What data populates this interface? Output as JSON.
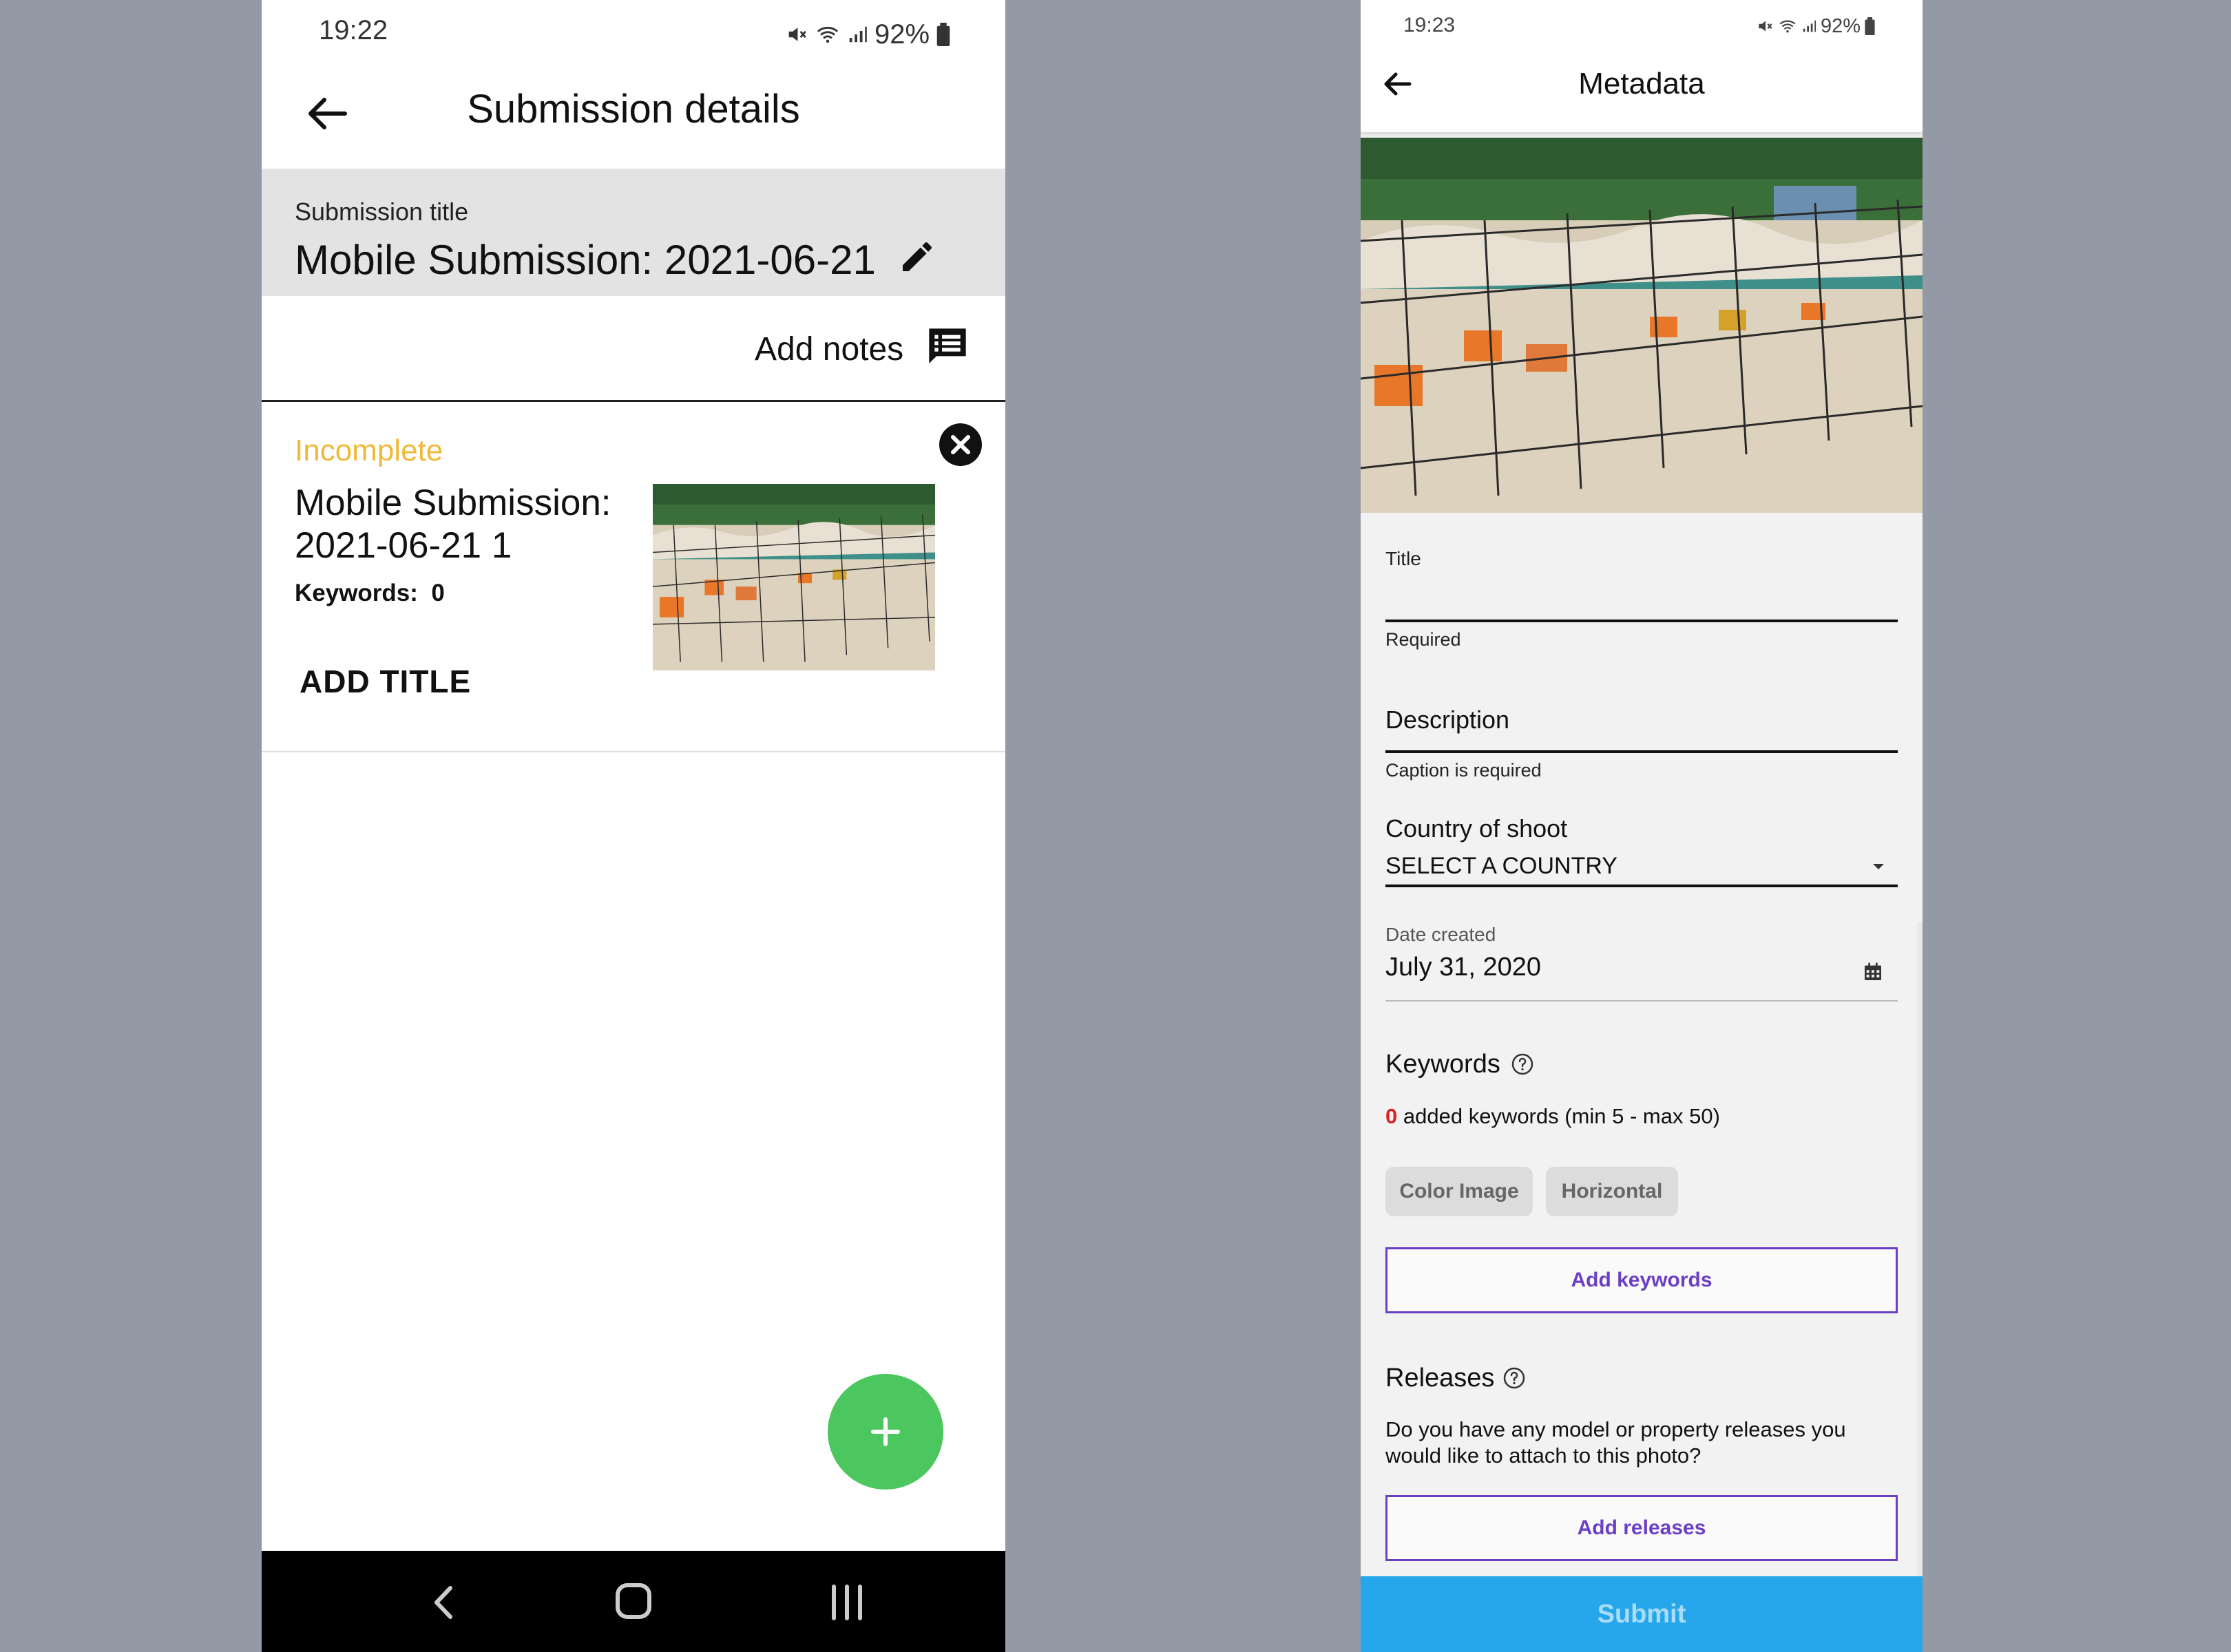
{
  "left": {
    "status": {
      "time": "19:22",
      "battery": "92%"
    },
    "appbar": {
      "title": "Submission details"
    },
    "submission": {
      "label": "Submission title",
      "value": "Mobile Submission: 2021-06-21"
    },
    "notes": {
      "label": "Add notes"
    },
    "card": {
      "status": "Incomplete",
      "title": "Mobile Submission: 2021-06-21 1",
      "keywords_label": "Keywords:",
      "keywords_count": "0",
      "add_title": "ADD TITLE"
    },
    "fab": {
      "icon": "plus-icon"
    },
    "nav": {
      "back": "back-nav-icon",
      "home": "home-nav-icon",
      "recents": "recents-nav-icon"
    }
  },
  "right": {
    "status": {
      "time": "19:23",
      "battery": "92%"
    },
    "appbar": {
      "title": "Metadata"
    },
    "title_field": {
      "label": "Title",
      "helper": "Required"
    },
    "description_field": {
      "label": "Description",
      "helper": "Caption is required"
    },
    "country_field": {
      "label": "Country of shoot",
      "value": "SELECT A COUNTRY"
    },
    "date_field": {
      "label": "Date created",
      "value": "July 31, 2020"
    },
    "keywords": {
      "title": "Keywords",
      "count": "0",
      "count_suffix": "added keywords (min 5 - max 50)",
      "chips": [
        "Color Image",
        "Horizontal"
      ],
      "add_button": "Add keywords"
    },
    "releases": {
      "title": "Releases",
      "question": "Do you have any model or property releases you would like to attach to this photo?",
      "add_button": "Add releases"
    },
    "submit": "Submit"
  },
  "colors": {
    "incomplete": "#f0b93a",
    "fab_green": "#4cc75f",
    "accent_purple": "#6b3fc4",
    "submit_blue": "#26a7eb",
    "error_red": "#e02020"
  }
}
